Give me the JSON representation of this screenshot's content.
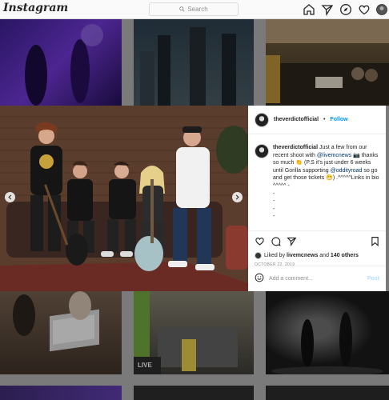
{
  "nav": {
    "logo": "Instagram",
    "search_placeholder": "Search",
    "icons": [
      "home-icon",
      "direct-icon",
      "explore-icon",
      "activity-icon",
      "profile-icon"
    ]
  },
  "post": {
    "username": "theverdictofficial",
    "separator": "•",
    "follow_label": "Follow",
    "caption": {
      "username": "theverdictofficial",
      "text1": " Just a few from our recent shoot with ",
      "mention1": "@livemcnews",
      "text2": " 📷 thanks so much 👏 (P.S it's just under 6 weeks until Gorilla supporting ",
      "mention2": "@oddityroad",
      "text3": " so go and get those tickets 😁) .^^^^^Links in bio ^^^^^ -",
      "dashes": [
        "-",
        "-",
        "-",
        "-"
      ]
    },
    "liked_prefix": "Liked by ",
    "liked_user": "livemcnews",
    "liked_mid": " and ",
    "liked_count": "140 others",
    "date": "OCTOBER 22, 2019",
    "comment_placeholder": "Add a comment...",
    "post_label": "Post",
    "icons": [
      "heart-icon",
      "comment-icon",
      "share-icon",
      "bookmark-icon",
      "emoji-icon"
    ]
  },
  "tiles": [
    "live-tile-label"
  ],
  "tile_text": {
    "live": "LIVE"
  }
}
